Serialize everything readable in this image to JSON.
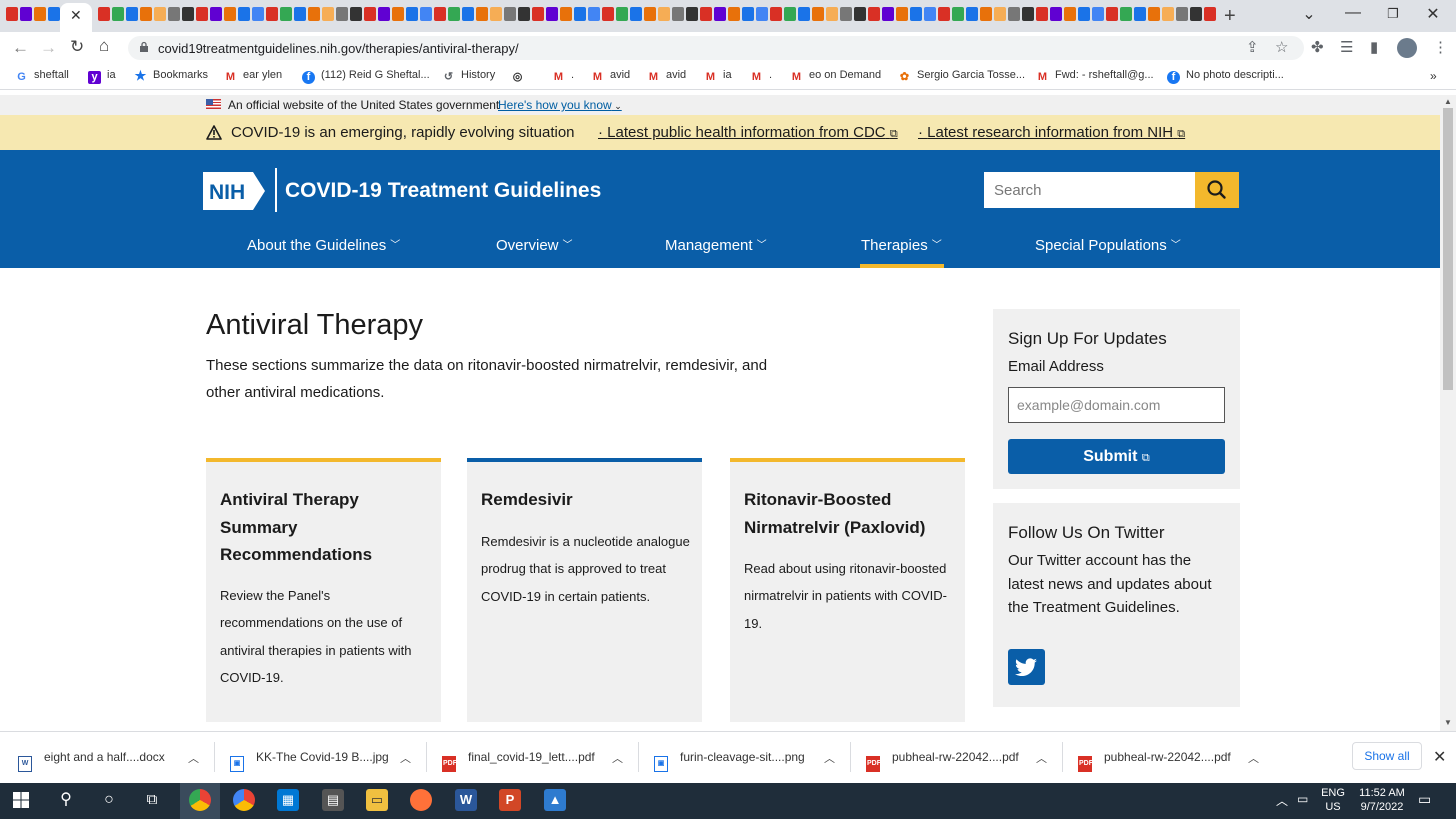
{
  "browser": {
    "url": "covid19treatmentguidelines.nih.gov/therapies/antiviral-therapy/",
    "bookmarks": [
      "sheftall",
      "ia",
      "Bookmarks",
      "ear ylen",
      "(112) Reid G Sheftal...",
      "History",
      "",
      ".",
      "avid",
      "avid",
      "ia",
      ".",
      "eo on Demand",
      "Sergio Garcia Tosse...",
      "Fwd: - rsheftall@g...",
      "No photo descripti..."
    ]
  },
  "gov_banner": {
    "text": "An official website of the United States government",
    "link": "Here's how you know"
  },
  "alert": {
    "text": "COVID-19 is an emerging, rapidly evolving situation",
    "link_cdc": "Latest public health information from CDC",
    "link_nih": "Latest research information from NIH"
  },
  "header": {
    "logo_text": "NIH",
    "site_title": "COVID-19 Treatment Guidelines",
    "search_placeholder": "Search",
    "nav": [
      "About the Guidelines",
      "Overview",
      "Management",
      "Therapies",
      "Special Populations"
    ],
    "active_nav": "Therapies",
    "accent_color": "#f3b82c",
    "brand_color": "#0a5ea8"
  },
  "main": {
    "title": "Antiviral Therapy",
    "description": "These sections summarize the data on ritonavir-boosted nirmatrelvir, remdesivir, and other antiviral medications.",
    "cards": [
      {
        "title": "Antiviral Therapy Summary Recommendations",
        "body": "Review the Panel's recommendations on the use of antiviral therapies in patients with COVID-19."
      },
      {
        "title": "Remdesivir",
        "body": "Remdesivir is a nucleotide analogue prodrug that is approved to treat COVID-19 in certain patients."
      },
      {
        "title": "Ritonavir-Boosted Nirmatrelvir (Paxlovid)",
        "body": "Read about using ritonavir-boosted nirmatrelvir in patients with COVID-19."
      }
    ]
  },
  "sidebar": {
    "signup_title": "Sign Up For Updates",
    "email_label": "Email Address",
    "email_placeholder": "example@domain.com",
    "submit_label": "Submit",
    "twitter_title": "Follow Us On Twitter",
    "twitter_desc": "Our Twitter account has the latest news and updates about the Treatment Guidelines."
  },
  "downloads": {
    "items": [
      "eight and a half....docx",
      "KK-The Covid-19 B....jpg",
      "final_covid-19_lett....pdf",
      "furin-cleavage-sit....png",
      "pubheal-rw-22042....pdf",
      "pubheal-rw-22042....pdf"
    ],
    "show_all": "Show all"
  },
  "taskbar": {
    "lang": "ENG",
    "region": "US",
    "time": "11:52 AM",
    "date": "9/7/2022"
  }
}
